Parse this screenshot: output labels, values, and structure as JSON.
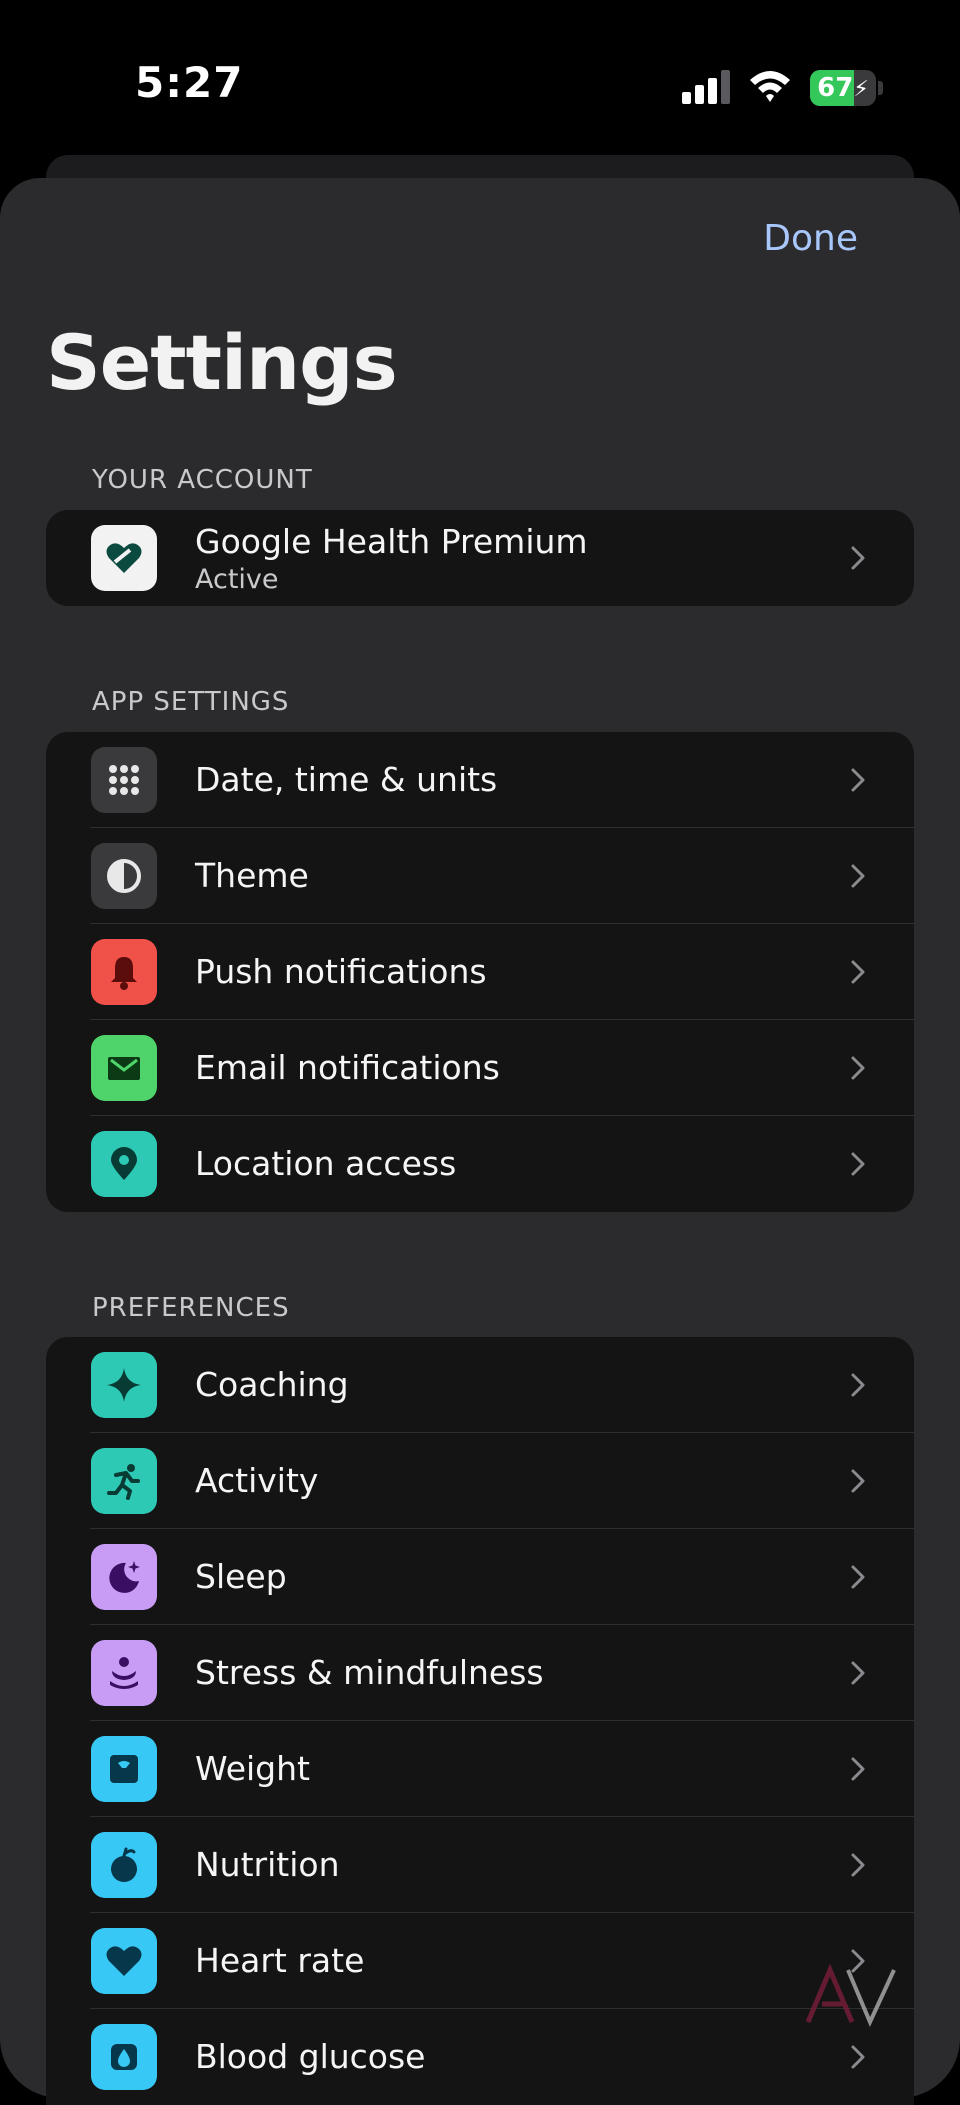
{
  "status_bar": {
    "time": "5:27",
    "battery": "67",
    "battery_fraction": 0.67
  },
  "header": {
    "done_label": "Done",
    "title": "Settings"
  },
  "account": {
    "section_label": "YOUR ACCOUNT",
    "item": {
      "title": "Google Health Premium",
      "subtitle": "Active",
      "icon": "health-heart-icon"
    }
  },
  "app_settings": {
    "section_label": "APP SETTINGS",
    "items": [
      {
        "label": "Date, time & units",
        "icon": "grid-dots-icon",
        "color": "#3a3a3c"
      },
      {
        "label": "Theme",
        "icon": "theme-contrast-icon",
        "color": "#3a3a3c"
      },
      {
        "label": "Push notifications",
        "icon": "bell-icon",
        "color": "#f0524a"
      },
      {
        "label": "Email notifications",
        "icon": "mail-icon",
        "color": "#4ed46a"
      },
      {
        "label": "Location access",
        "icon": "location-pin-icon",
        "color": "#2ec9b5"
      }
    ]
  },
  "preferences": {
    "section_label": "PREFERENCES",
    "items": [
      {
        "label": "Coaching",
        "icon": "sparkle-icon",
        "color": "#2ec9b5"
      },
      {
        "label": "Activity",
        "icon": "running-icon",
        "color": "#2ec9b5"
      },
      {
        "label": "Sleep",
        "icon": "moon-icon",
        "color": "#c89cf5"
      },
      {
        "label": "Stress & mindfulness",
        "icon": "mindfulness-icon",
        "color": "#c89cf5"
      },
      {
        "label": "Weight",
        "icon": "scale-icon",
        "color": "#38c8f5"
      },
      {
        "label": "Nutrition",
        "icon": "apple-icon",
        "color": "#38c8f5"
      },
      {
        "label": "Heart rate",
        "icon": "heart-icon",
        "color": "#38c8f5"
      },
      {
        "label": "Blood glucose",
        "icon": "drop-icon",
        "color": "#38c8f5"
      }
    ]
  }
}
